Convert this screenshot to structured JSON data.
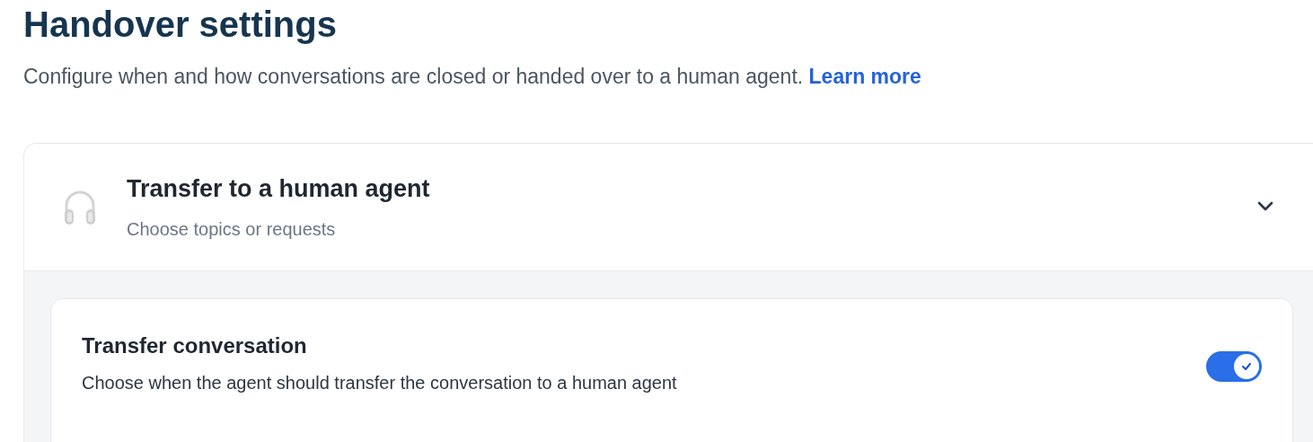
{
  "page": {
    "title": "Handover settings",
    "description": "Configure when and how conversations are closed or handed over to a human agent.",
    "link": "Learn more"
  },
  "section": {
    "title": "Transfer to a human agent",
    "subtitle": "Choose topics or requests",
    "expanded": true,
    "settings": [
      {
        "title": "Transfer conversation",
        "description": "Choose when the agent should transfer the conversation to a human agent",
        "on": true
      }
    ]
  }
}
